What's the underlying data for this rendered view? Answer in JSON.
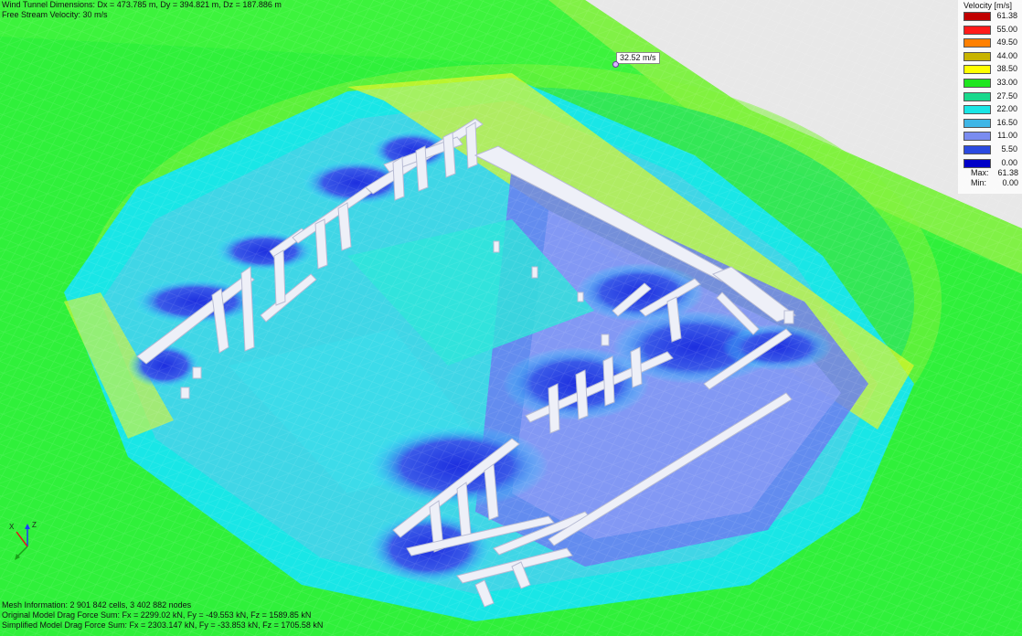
{
  "info": {
    "wind_tunnel": "Wind Tunnel Dimensions: Dx = 473.785 m, Dy = 394.821 m, Dz = 187.886 m",
    "free_stream": "Free Stream Velocity: 30 m/s",
    "mesh": "Mesh Information: 2 901 842 cells, 3 402 882 nodes",
    "original_drag": "Original Model Drag Force Sum: Fx = 2299.02 kN, Fy = -49.553 kN, Fz = 1589.85 kN",
    "simplified_drag": "Simplified Model Drag Force Sum: Fx = 2303.147 kN, Fy = -33.853 kN, Fz = 1705.58 kN"
  },
  "probe": {
    "label": "32.52 m/s"
  },
  "legend": {
    "title": "Velocity [m/s]",
    "rows": [
      {
        "value": "61.38",
        "color": "#c00000"
      },
      {
        "value": "55.00",
        "color": "#ff1a1a"
      },
      {
        "value": "49.50",
        "color": "#ff8000"
      },
      {
        "value": "44.00",
        "color": "#c8b400"
      },
      {
        "value": "38.50",
        "color": "#ffff00"
      },
      {
        "value": "33.00",
        "color": "#1fe61f"
      },
      {
        "value": "27.50",
        "color": "#19d98c"
      },
      {
        "value": "22.00",
        "color": "#19e6e6"
      },
      {
        "value": "16.50",
        "color": "#3fb6e6"
      },
      {
        "value": "11.00",
        "color": "#7a8cf0"
      },
      {
        "value": "5.50",
        "color": "#2a4ae0"
      },
      {
        "value": "0.00",
        "color": "#0000c8"
      }
    ],
    "max_label": "Max:",
    "max_value": "61.38",
    "min_label": "Min:",
    "min_value": "0.00"
  },
  "axes": {
    "z": "Z",
    "x": "X"
  }
}
